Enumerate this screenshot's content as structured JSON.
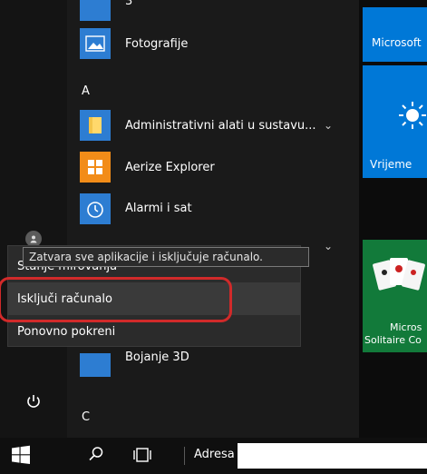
{
  "app_list": {
    "top_partial_label": "3",
    "items": [
      {
        "label": "Fotografije",
        "icon": "photos-icon"
      },
      {
        "label": "Administrativni alati u sustavu...",
        "icon": "folder-icon"
      },
      {
        "label": "Aerize Explorer",
        "icon": "aerize-icon"
      },
      {
        "label": "Alarmi i sat",
        "icon": "alarm-clock-icon"
      },
      {
        "label": "Bojanje 3D",
        "icon": "paint3d-icon"
      }
    ],
    "section_letters": [
      "A",
      "C"
    ]
  },
  "tiles": [
    {
      "name": "tile-microsoft",
      "label": "Microsoft"
    },
    {
      "name": "tile-weather",
      "label": "Vrijeme",
      "icon": "sun-icon"
    },
    {
      "name": "tile-solitaire",
      "label_line1": "Micros",
      "label_line2": "Solitaire Co"
    }
  ],
  "power_menu": {
    "tooltip": "Zatvara sve aplikacije i isključuje računalo.",
    "items": [
      {
        "label": "Stanje mirovanja"
      },
      {
        "label": "Isključi računalo"
      },
      {
        "label": "Ponovno pokreni"
      }
    ]
  },
  "rail": {
    "user_icon": "user-icon",
    "power_icon": "power-icon"
  },
  "taskbar": {
    "address_label": "Adresa",
    "address_value": ""
  },
  "colors": {
    "accent": "#0078d7",
    "highlight": "#d12a2a"
  }
}
